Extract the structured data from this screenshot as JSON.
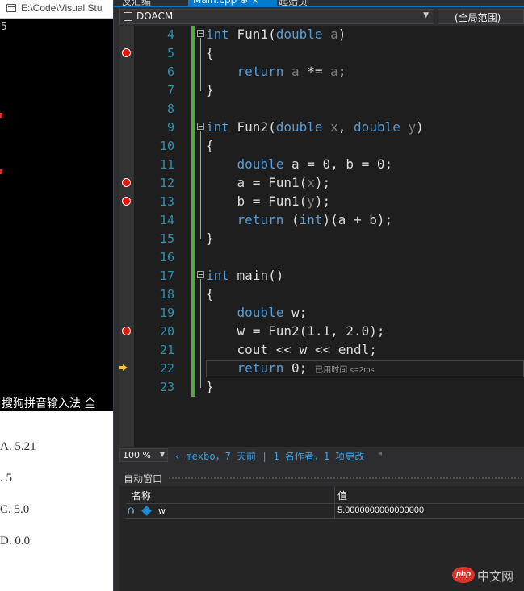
{
  "console": {
    "title": "E:\\Code\\Visual Stu",
    "output": "5",
    "ime_status": "搜狗拼音输入法 全"
  },
  "answers": [
    {
      "text": "A. 5.21"
    },
    {
      "text": ". 5"
    },
    {
      "text": "C. 5.0"
    },
    {
      "text": "D. 0.0"
    }
  ],
  "tabs": [
    {
      "label": "反汇编"
    },
    {
      "label": "Main.cpp  ⊕  ×"
    },
    {
      "label": "起始页"
    }
  ],
  "navbar": {
    "project": "DOACM",
    "scope": "(全局范围)"
  },
  "editor": {
    "lines": [
      {
        "n": "4",
        "bp": false,
        "fold": true,
        "html": "<span class='kw'>int</span> Fun1(<span class='kw'>double</span> <span class='pm'>a</span>)"
      },
      {
        "n": "5",
        "bp": true,
        "fold": false,
        "html": "{"
      },
      {
        "n": "6",
        "bp": false,
        "fold": false,
        "html": "    <span class='kw'>return</span> <span class='pm'>a</span> *= <span class='pm'>a</span>;"
      },
      {
        "n": "7",
        "bp": false,
        "fold": false,
        "html": "}"
      },
      {
        "n": "8",
        "bp": false,
        "fold": false,
        "html": ""
      },
      {
        "n": "9",
        "bp": false,
        "fold": true,
        "html": "<span class='kw'>int</span> Fun2(<span class='kw'>double</span> <span class='pm'>x</span>, <span class='kw'>double</span> <span class='pm'>y</span>)"
      },
      {
        "n": "10",
        "bp": false,
        "fold": false,
        "html": "{"
      },
      {
        "n": "11",
        "bp": false,
        "fold": false,
        "html": "    <span class='kw'>double</span> a = 0, b = 0;"
      },
      {
        "n": "12",
        "bp": true,
        "fold": false,
        "html": "    a = Fun1(<span class='pm'>x</span>);"
      },
      {
        "n": "13",
        "bp": true,
        "fold": false,
        "html": "    b = Fun1(<span class='pm'>y</span>);"
      },
      {
        "n": "14",
        "bp": false,
        "fold": false,
        "html": "    <span class='kw'>return</span> (<span class='kw'>int</span>)(a + b);"
      },
      {
        "n": "15",
        "bp": false,
        "fold": false,
        "html": "}"
      },
      {
        "n": "16",
        "bp": false,
        "fold": false,
        "html": ""
      },
      {
        "n": "17",
        "bp": false,
        "fold": true,
        "html": "<span class='kw'>int</span> main()"
      },
      {
        "n": "18",
        "bp": false,
        "fold": false,
        "html": "{"
      },
      {
        "n": "19",
        "bp": false,
        "fold": false,
        "html": "    <span class='kw'>double</span> w;"
      },
      {
        "n": "20",
        "bp": true,
        "fold": false,
        "html": "    w = Fun2(1.1, 2.0);"
      },
      {
        "n": "21",
        "bp": false,
        "fold": false,
        "html": "    cout &lt;&lt; w &lt;&lt; endl;"
      },
      {
        "n": "22",
        "bp": false,
        "fold": false,
        "current": true,
        "html": "    <span class='kw'>return</span> 0;<span class='perf'>已用时间 &lt;=2ms</span>"
      },
      {
        "n": "23",
        "bp": false,
        "fold": false,
        "html": "}"
      }
    ]
  },
  "status": {
    "zoom": "100 %",
    "author": "mexbo，7 天前",
    "changes": "1 名作者，1 项更改"
  },
  "autos": {
    "title": "自动窗口",
    "col_name": "名称",
    "col_value": "值",
    "rows": [
      {
        "name": "w",
        "value": "5.0000000000000000"
      }
    ]
  },
  "watermark": {
    "logo": "php",
    "text": "中文网"
  },
  "colors": {
    "accent": "#007acc",
    "breakpoint": "#e51400",
    "keyword": "#569cd6",
    "change_bar": "#57a64a"
  }
}
